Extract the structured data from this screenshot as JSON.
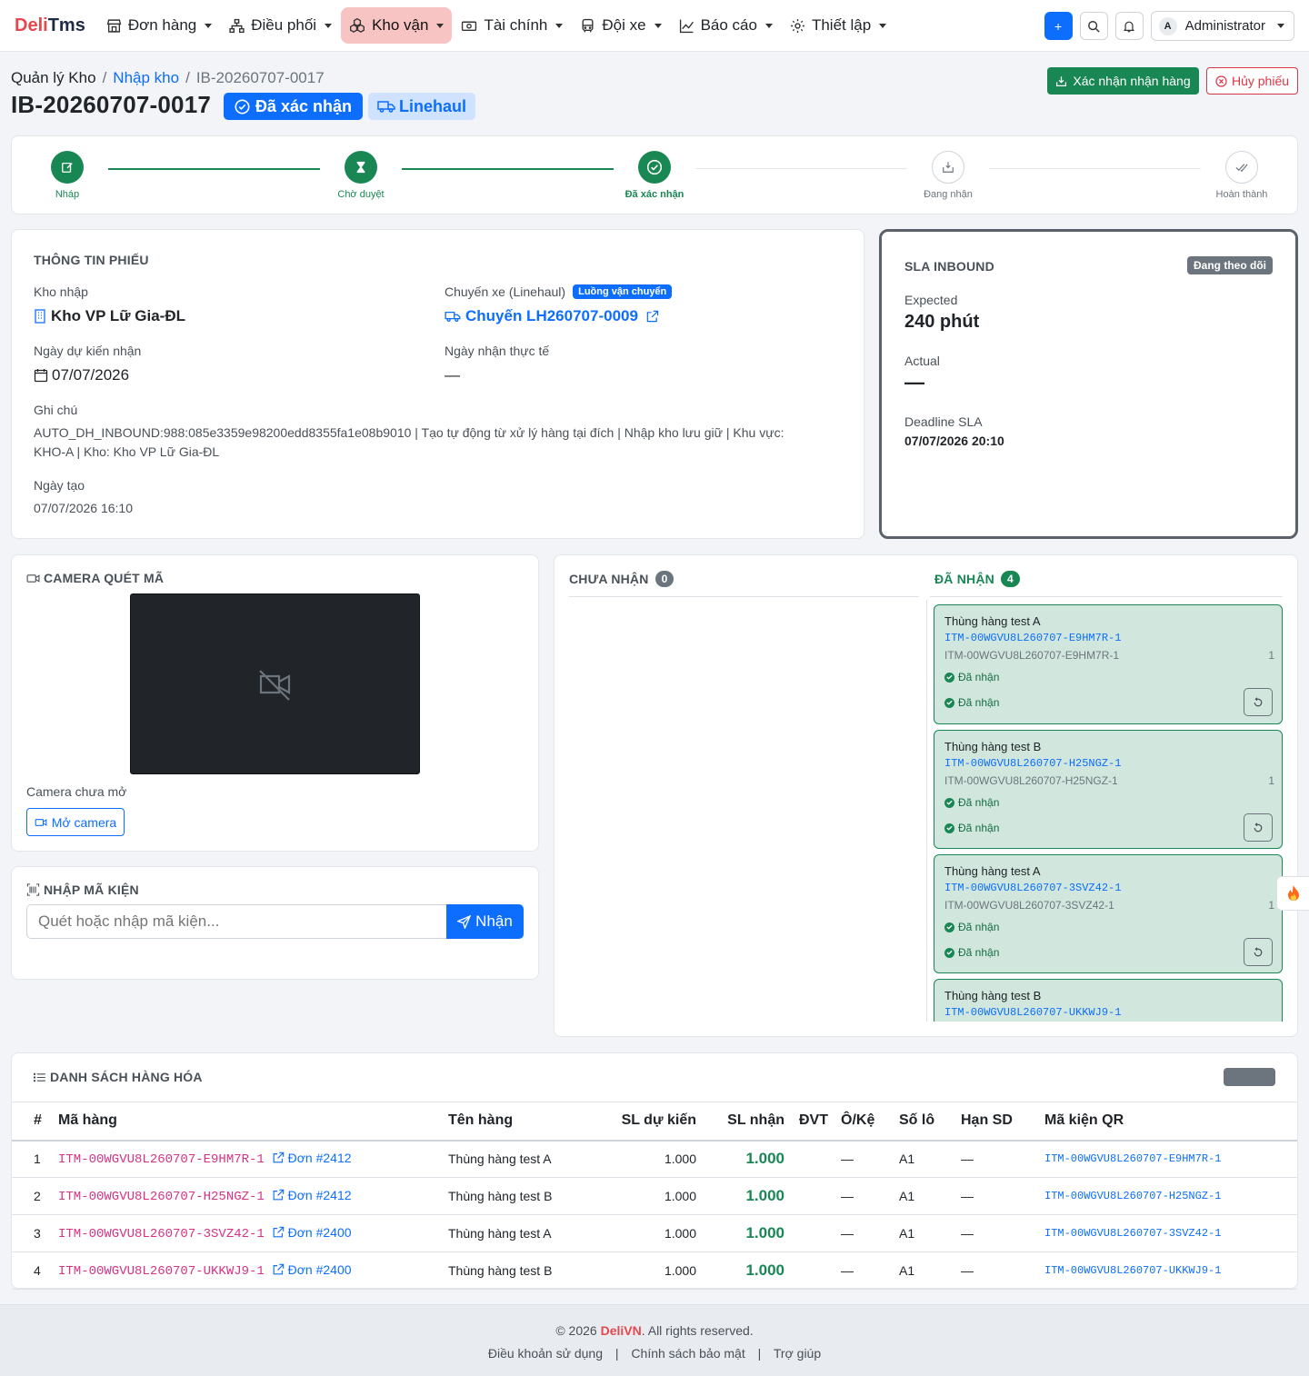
{
  "logo": {
    "part1": "Deli",
    "part2": "Tms"
  },
  "nav": {
    "items": [
      {
        "label": "Đơn hàng",
        "icon": "store-icon"
      },
      {
        "label": "Điều phối",
        "icon": "sitemap-icon"
      },
      {
        "label": "Kho vận",
        "icon": "boxes-icon",
        "active": true
      },
      {
        "label": "Tài chính",
        "icon": "cash-icon"
      },
      {
        "label": "Đội xe",
        "icon": "bus-icon"
      },
      {
        "label": "Báo cáo",
        "icon": "chart-line-icon"
      },
      {
        "label": "Thiết lập",
        "icon": "gear-icon"
      }
    ],
    "user_initial": "A",
    "user_name": "Administrator"
  },
  "breadcrumb": {
    "root": "Quản lý Kho",
    "sep": "/",
    "parent": "Nhập kho",
    "current": "IB-20260707-0017"
  },
  "page": {
    "title": "IB-20260707-0017",
    "status_badge": "Đã xác nhận",
    "type_badge": "Linehaul",
    "confirm_button": "Xác nhận nhận hàng",
    "cancel_button": "Hủy phiếu"
  },
  "stepper": {
    "steps": [
      {
        "label": "Nháp",
        "state": "done"
      },
      {
        "label": "Chờ duyệt",
        "state": "done"
      },
      {
        "label": "Đã xác nhận",
        "state": "current"
      },
      {
        "label": "Đang nhận",
        "state": "todo"
      },
      {
        "label": "Hoàn thành",
        "state": "todo"
      }
    ]
  },
  "info": {
    "section_title": "THÔNG TIN PHIẾU",
    "warehouse_label": "Kho nhập",
    "warehouse_value": "Kho VP Lữ Gia-ĐL",
    "trip_label": "Chuyến xe (Linehaul)",
    "trip_badge": "Luồng vận chuyển",
    "trip_value": "Chuyến LH260707-0009",
    "expected_date_label": "Ngày dự kiến nhận",
    "expected_date_value": "07/07/2026",
    "actual_date_label": "Ngày nhận thực tế",
    "actual_date_value": "—",
    "note_label": "Ghi chú",
    "note_line1": "AUTO_DH_INBOUND:988:085e3359e98200edd8355fa1e08b9010 | Tạo tự động từ xử lý hàng tại đích | Nhập kho lưu giữ | Khu vực:",
    "note_line2": "KHO-A | Kho: Kho VP Lữ Gia-ĐL",
    "created_label": "Ngày tạo",
    "created_value": "07/07/2026 16:10"
  },
  "sla": {
    "title": "SLA INBOUND",
    "badge": "Đang theo dõi",
    "expected_label": "Expected",
    "expected_value": "240 phút",
    "actual_label": "Actual",
    "actual_value": "—",
    "deadline_label": "Deadline SLA",
    "deadline_value": "07/07/2026 20:10"
  },
  "camera": {
    "title": "CAMERA QUÉT MÃ",
    "status": "Camera chưa mở",
    "open_button": "Mở camera"
  },
  "manual": {
    "title": "NHẬP MÃ KIỆN",
    "placeholder": "Quét hoặc nhập mã kiện...",
    "submit": "Nhận"
  },
  "pending": {
    "title": "CHƯA NHẬN",
    "count": "0"
  },
  "received": {
    "title": "ĐÃ NHẬN",
    "count": "4",
    "items": [
      {
        "name": "Thùng hàng test A",
        "code": "ITM-00WGVU8L260707-E9HM7R-1",
        "code2": "ITM-00WGVU8L260707-E9HM7R-1",
        "qty": "1",
        "status1": "Đã nhận",
        "status2": "Đã nhận"
      },
      {
        "name": "Thùng hàng test B",
        "code": "ITM-00WGVU8L260707-H25NGZ-1",
        "code2": "ITM-00WGVU8L260707-H25NGZ-1",
        "qty": "1",
        "status1": "Đã nhận",
        "status2": "Đã nhận"
      },
      {
        "name": "Thùng hàng test A",
        "code": "ITM-00WGVU8L260707-3SVZ42-1",
        "code2": "ITM-00WGVU8L260707-3SVZ42-1",
        "qty": "1",
        "status1": "Đã nhận",
        "status2": "Đã nhận"
      },
      {
        "name": "Thùng hàng test B",
        "code": "ITM-00WGVU8L260707-UKKWJ9-1"
      }
    ]
  },
  "goods": {
    "title": "DANH SÁCH HÀNG HÓA",
    "headers": [
      "#",
      "Mã hàng",
      "Tên hàng",
      "SL dự kiến",
      "SL nhận",
      "ĐVT",
      "Ô/Kệ",
      "Số lô",
      "Hạn SD",
      "Mã kiện QR"
    ],
    "rows": [
      {
        "no": "1",
        "code": "ITM-00WGVU8L260707-E9HM7R-1",
        "order": "Đơn #2412",
        "name": "Thùng hàng test A",
        "expected": "1.000",
        "received": "1.000",
        "unit": "",
        "shelf": "—",
        "lot": "A1",
        "expiry": "—",
        "qr": "ITM-00WGVU8L260707-E9HM7R-1"
      },
      {
        "no": "2",
        "code": "ITM-00WGVU8L260707-H25NGZ-1",
        "order": "Đơn #2412",
        "name": "Thùng hàng test B",
        "expected": "1.000",
        "received": "1.000",
        "unit": "",
        "shelf": "—",
        "lot": "A1",
        "expiry": "—",
        "qr": "ITM-00WGVU8L260707-H25NGZ-1"
      },
      {
        "no": "3",
        "code": "ITM-00WGVU8L260707-3SVZ42-1",
        "order": "Đơn #2400",
        "name": "Thùng hàng test A",
        "expected": "1.000",
        "received": "1.000",
        "unit": "",
        "shelf": "—",
        "lot": "A1",
        "expiry": "—",
        "qr": "ITM-00WGVU8L260707-3SVZ42-1"
      },
      {
        "no": "4",
        "code": "ITM-00WGVU8L260707-UKKWJ9-1",
        "order": "Đơn #2400",
        "name": "Thùng hàng test B",
        "expected": "1.000",
        "received": "1.000",
        "unit": "",
        "shelf": "—",
        "lot": "A1",
        "expiry": "—",
        "qr": "ITM-00WGVU8L260707-UKKWJ9-1"
      }
    ]
  },
  "footer": {
    "copyright_pre": "© 2026 ",
    "brand_part1": "Deli",
    "brand_part2": "VN",
    "copyright_post": ". All rights reserved.",
    "links": [
      "Điều khoản sử dụng",
      "Chính sách bảo mật",
      "Trợ giúp"
    ],
    "sep": "|"
  },
  "colors": {
    "primary": "#0d6efd",
    "success": "#198754",
    "danger": "#dc3545",
    "brand": "#e5484d"
  }
}
